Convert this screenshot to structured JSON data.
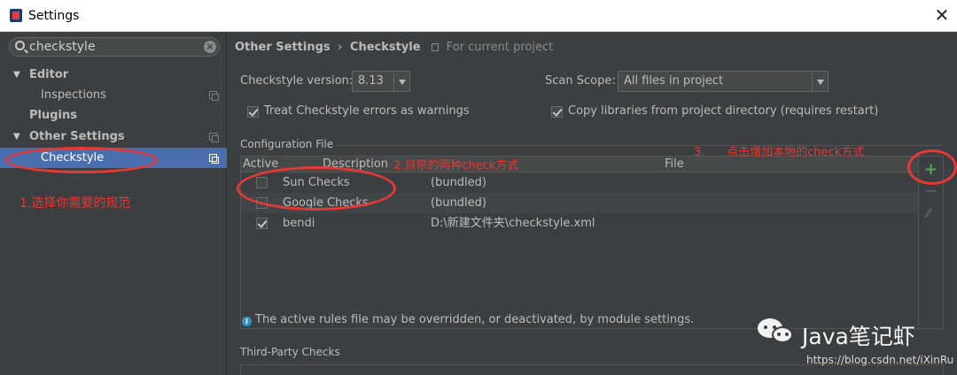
{
  "window": {
    "title": "Settings",
    "close_glyph": "✕"
  },
  "sidebar": {
    "search_value": "checkstyle",
    "items": [
      {
        "label": "Editor",
        "expanded": true
      },
      {
        "label": "Inspections"
      },
      {
        "label": "Plugins"
      },
      {
        "label": "Other Settings",
        "expanded": true
      },
      {
        "label": "Checkstyle",
        "selected": true
      }
    ]
  },
  "breadcrumb": {
    "parent": "Other Settings",
    "separator": "›",
    "current": "Checkstyle",
    "note": "For current project"
  },
  "settings": {
    "version_label": "Checkstyle version:",
    "version_value": "8.13",
    "scope_label": "Scan Scope:",
    "scope_value": "All files in project",
    "treat_errors_label": "Treat Checkstyle errors as warnings",
    "treat_errors_checked": true,
    "copy_libs_label": "Copy libraries from project directory (requires restart)",
    "copy_libs_checked": true
  },
  "config": {
    "section_title": "Configuration File",
    "columns": [
      "Active",
      "Description",
      "File"
    ],
    "rows": [
      {
        "active": false,
        "description": "Sun Checks",
        "file": "(bundled)"
      },
      {
        "active": false,
        "description": "Google Checks",
        "file": "(bundled)"
      },
      {
        "active": true,
        "description": "bendi",
        "file": "D:\\新建文件夹\\checkstyle.xml"
      }
    ],
    "add_glyph": "+",
    "info_text": "The active rules file may be overridden, or deactivated, by module settings."
  },
  "third_party": {
    "section_title": "Third-Party Checks"
  },
  "annotations": {
    "step1": "1.选择你需要的规范",
    "step2": "2.自带的两种check方式",
    "step3": "3.      点击增加本地的check方式"
  },
  "watermark": {
    "name": "Java笔记虾",
    "url": "https://blog.csdn.net/iXinRu"
  },
  "colors": {
    "accent": "#4b6eaf",
    "annotation": "#e53935",
    "add": "#58a55c"
  }
}
